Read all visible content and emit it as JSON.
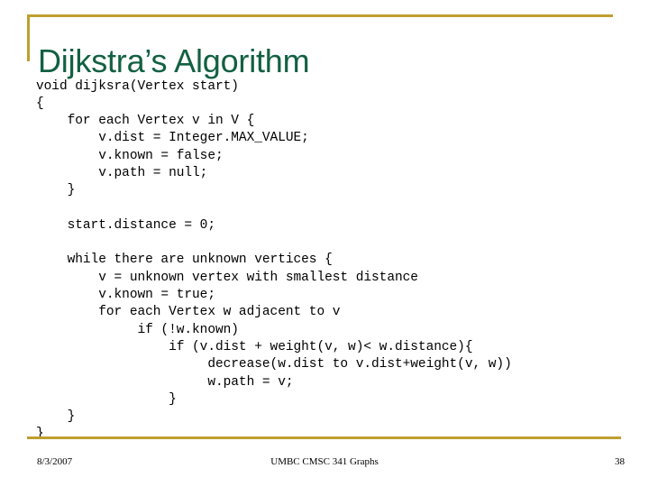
{
  "slide": {
    "title": "Dijkstra’s Algorithm",
    "accent_color": "#bf9f30",
    "title_color": "#136043",
    "code": [
      "void dijksra(Vertex start)",
      "{",
      "    for each Vertex v in V {",
      "        v.dist = Integer.MAX_VALUE;",
      "        v.known = false;",
      "        v.path = null;",
      "    }",
      "",
      "    start.distance = 0;",
      "",
      "    while there are unknown vertices {",
      "        v = unknown vertex with smallest distance",
      "        v.known = true;",
      "        for each Vertex w adjacent to v",
      "             if (!w.known)",
      "                 if (v.dist + weight(v, w)< w.distance){",
      "                      decrease(w.dist to v.dist+weight(v, w))",
      "                      w.path = v;",
      "                 }",
      "    }",
      "}"
    ]
  },
  "footer": {
    "date": "8/3/2007",
    "center": "UMBC CMSC 341 Graphs",
    "page": "38"
  }
}
